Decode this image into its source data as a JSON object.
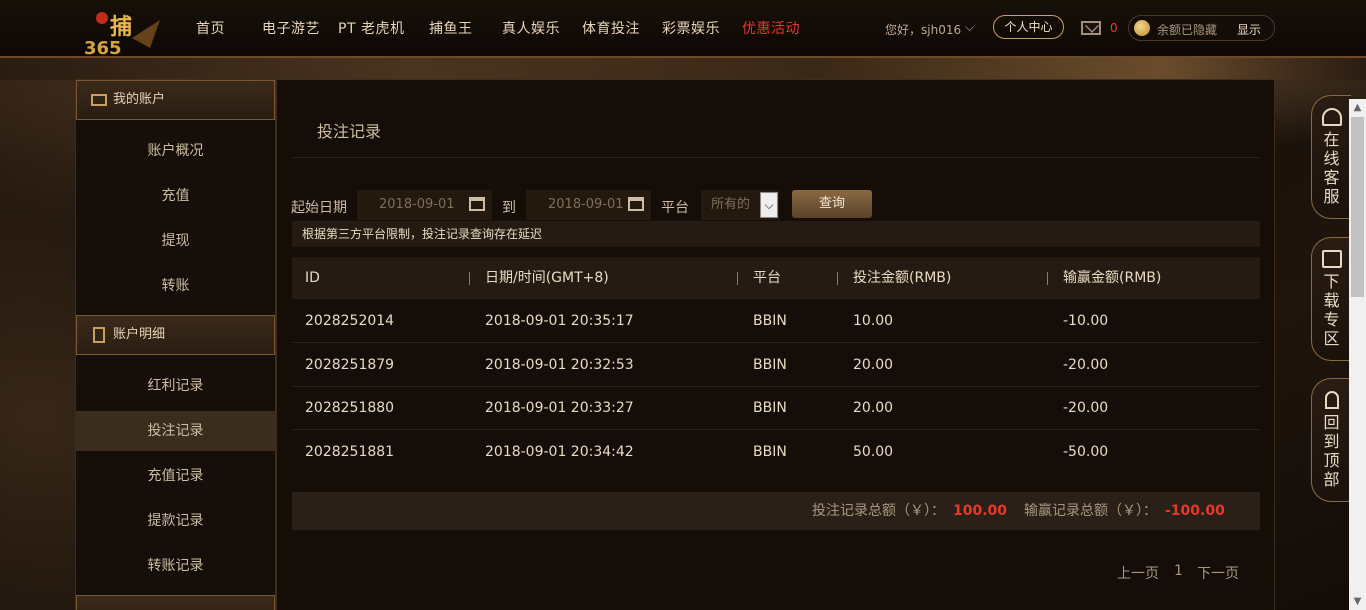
{
  "header": {
    "nav": [
      "首页",
      "电子游艺",
      "PT 老虎机",
      "捕鱼王",
      "真人娱乐",
      "体育投注",
      "彩票娱乐",
      "优惠活动"
    ],
    "greeting": "您好，sjh016",
    "personal_center": "个人中心",
    "mail_count": "0",
    "balance_hidden": "余额已隐藏",
    "show": "显示",
    "logo_text": "捕365",
    "accent_color": "#e8382c"
  },
  "sidebar": {
    "account_title": "我的账户",
    "account_items": [
      "账户概况",
      "充值",
      "提现",
      "转账"
    ],
    "detail_title": "账户明细",
    "detail_items": [
      "红利记录",
      "投注记录",
      "充值记录",
      "提款记录",
      "转账记录"
    ],
    "selected": "投注记录"
  },
  "main": {
    "title": "投注记录",
    "start_label": "起始日期",
    "start_date": "2018-09-01",
    "to_label": "到",
    "end_date": "2018-09-01",
    "platform_label": "平台",
    "platform_value": "所有的",
    "query": "查询",
    "notice": "根据第三方平台限制，投注记录查询存在延迟",
    "columns": [
      "ID",
      "日期/时间(GMT+8)",
      "平台",
      "投注金额(RMB)",
      "输赢金额(RMB)"
    ],
    "rows": [
      [
        "2028252014",
        "2018-09-01 20:35:17",
        "BBIN",
        "10.00",
        "-10.00"
      ],
      [
        "2028251879",
        "2018-09-01 20:32:53",
        "BBIN",
        "20.00",
        "-20.00"
      ],
      [
        "2028251880",
        "2018-09-01 20:33:27",
        "BBIN",
        "20.00",
        "-20.00"
      ],
      [
        "2028251881",
        "2018-09-01 20:34:42",
        "BBIN",
        "50.00",
        "-50.00"
      ]
    ],
    "bet_total_label": "投注记录总额（￥）：",
    "bet_total": "100.00",
    "win_total_label": "输赢记录总额（￥）：",
    "win_total": "-100.00",
    "prev": "上一页",
    "page": "1",
    "next": "下一页"
  },
  "float": {
    "service": "在线客服",
    "download": "下载专区",
    "top": "回到顶部"
  }
}
